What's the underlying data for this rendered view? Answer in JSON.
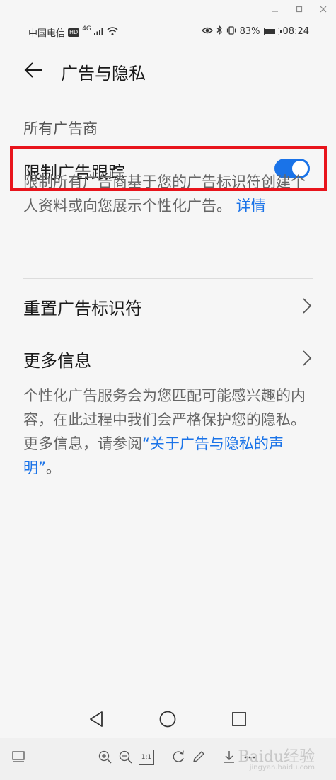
{
  "window": {
    "minimize_icon": "minimize-icon",
    "maximize_icon": "maximize-icon",
    "close_icon": "close-icon"
  },
  "status_bar": {
    "carrier": "中国电信",
    "hd": "HD",
    "network": "4G",
    "battery_percent": "83%",
    "battery_level": 0.83,
    "time": "08:24"
  },
  "header": {
    "title": "广告与隐私"
  },
  "section": {
    "label": "所有广告商"
  },
  "limit_tracking": {
    "label": "限制广告跟踪",
    "enabled": true,
    "description": "限制所有广告商基于您的广告标识符创建个人资料或向您展示个性化广告。",
    "details_link": "详情"
  },
  "reset_id": {
    "label": "重置广告标识符"
  },
  "more_info": {
    "label": "更多信息",
    "description": "个性化广告服务会为您匹配可能感兴趣的内容，在此过程中我们会严格保护您的隐私。更多信息，请参阅",
    "link": "“关于广告与隐私的声明”",
    "suffix": "。"
  },
  "toolbar": {
    "one_to_one": "1:1",
    "watermark": "Baidu经验",
    "watermark_sub": "jingyan.baidu.com"
  },
  "colors": {
    "accent": "#1a73e8",
    "highlight_border": "#e8141c"
  }
}
